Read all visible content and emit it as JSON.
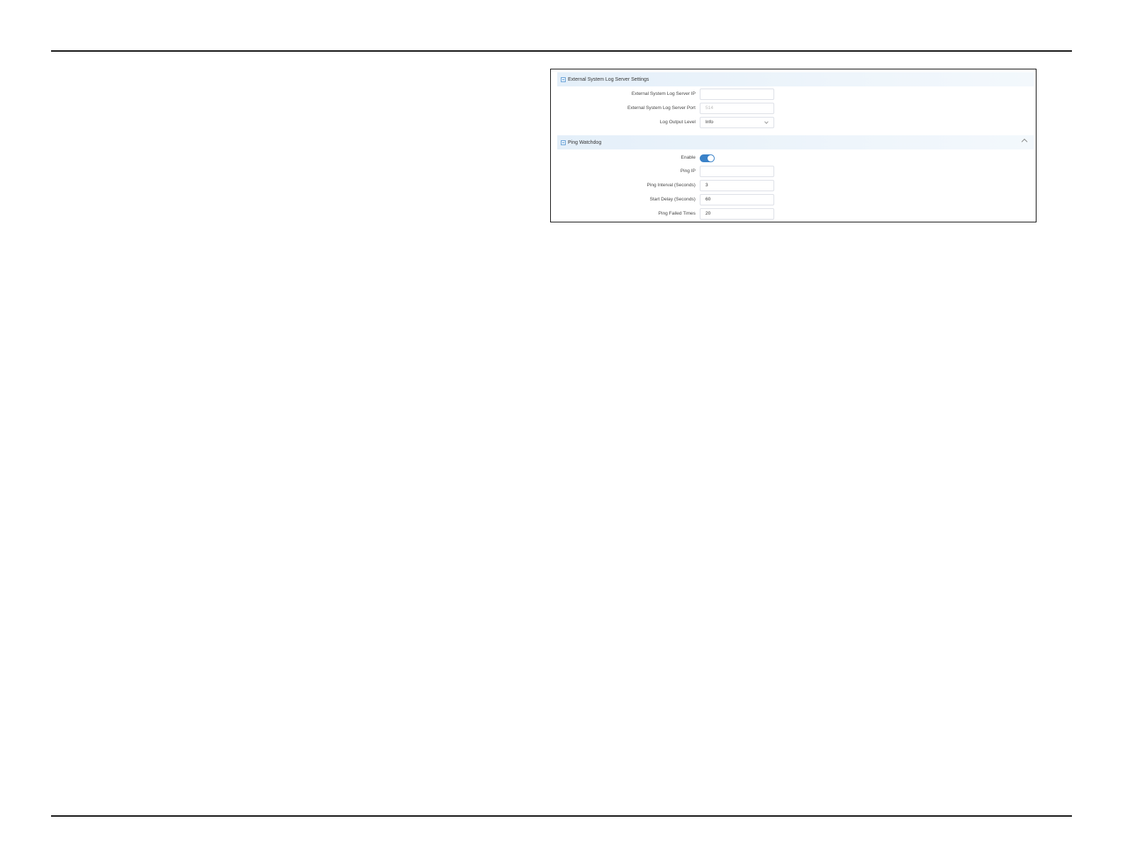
{
  "external_log": {
    "title": "External System Log Server Settings",
    "fields": [
      {
        "label": "External System Log Server IP",
        "value": "",
        "placeholder": ""
      },
      {
        "label": "External System Log Server Port",
        "value": "",
        "placeholder": "514"
      },
      {
        "label": "Log Output Level",
        "value": "Info"
      }
    ]
  },
  "ping_watchdog": {
    "title": "Ping Watchdog",
    "enable_label": "Enable",
    "enabled": true,
    "fields": [
      {
        "label": "Ping IP",
        "value": ""
      },
      {
        "label": "Ping Interval (Seconds)",
        "value": "3"
      },
      {
        "label": "Start Delay (Seconds)",
        "value": "60"
      },
      {
        "label": "Ping Failed Times",
        "value": "20"
      }
    ]
  },
  "colors": {
    "accent": "#3b82c8",
    "header_bg": "#e8f2fb",
    "input_border": "#dcdfe6"
  }
}
